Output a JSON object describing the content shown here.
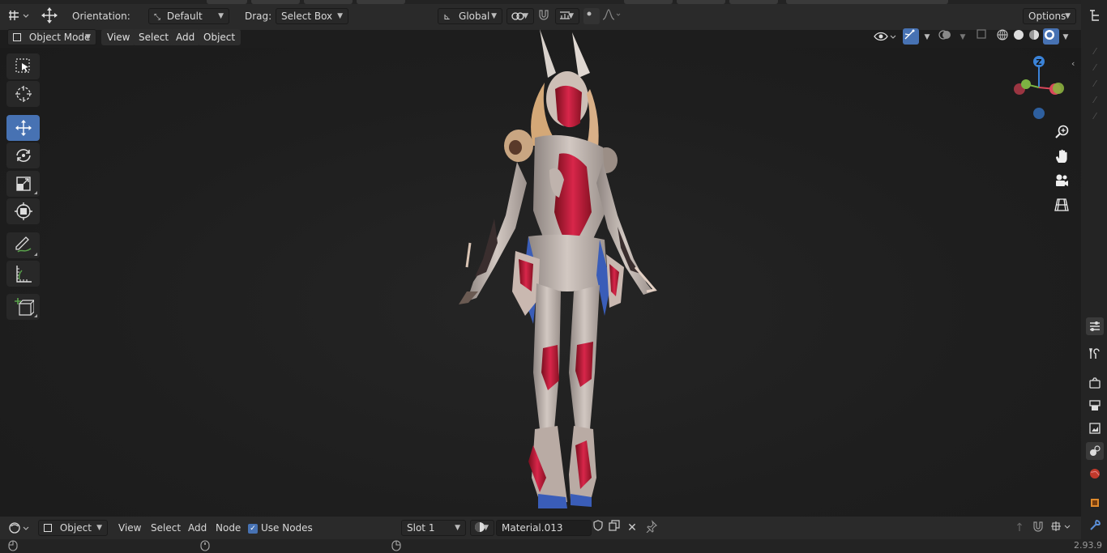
{
  "header": {
    "orientation_label": "Orientation:",
    "orientation_value": "Default",
    "drag_label": "Drag:",
    "drag_value": "Select Box",
    "transform_space": "Global",
    "options_label": "Options"
  },
  "viewport_header": {
    "mode": "Object Mode",
    "menus": [
      "View",
      "Select",
      "Add",
      "Object"
    ]
  },
  "tools": [
    {
      "name": "select-box-tool",
      "icon": "select-box-icon"
    },
    {
      "name": "cursor-tool",
      "icon": "cursor-icon"
    },
    {
      "name": "move-tool",
      "icon": "move-icon",
      "active": true
    },
    {
      "name": "rotate-tool",
      "icon": "rotate-icon"
    },
    {
      "name": "scale-tool",
      "icon": "scale-icon"
    },
    {
      "name": "transform-tool",
      "icon": "transform-icon"
    },
    {
      "name": "annotate-tool",
      "icon": "annotate-icon"
    },
    {
      "name": "measure-tool",
      "icon": "measure-icon"
    },
    {
      "name": "add-cube-tool",
      "icon": "add-cube-icon"
    }
  ],
  "gizmo": {
    "axis_z": "Z"
  },
  "node_editor_header": {
    "editor_type": "Object",
    "menus": [
      "View",
      "Select",
      "Add",
      "Node"
    ],
    "use_nodes_label": "Use Nodes",
    "use_nodes_checked": true,
    "slot": "Slot 1",
    "material": "Material.013"
  },
  "status": {
    "version": "2.93.9"
  },
  "colors": {
    "accent": "#4772b3",
    "axis_x": "#d9475a",
    "axis_y": "#7cb342",
    "axis_z": "#3b83d8"
  }
}
